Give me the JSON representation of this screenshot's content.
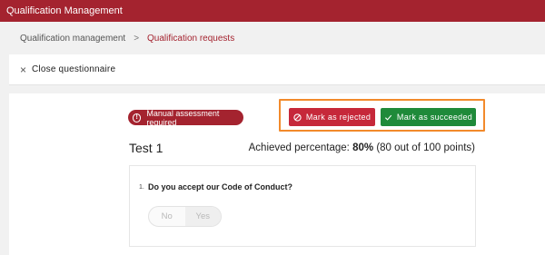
{
  "app": {
    "title": "Qualification Management"
  },
  "breadcrumb": {
    "root": "Qualification management",
    "separator": ">",
    "current": "Qualification requests"
  },
  "close_bar": {
    "label": "Close questionnaire"
  },
  "status_badge": {
    "label": "Manual assessment required"
  },
  "actions": {
    "reject_label": "Mark as rejected",
    "success_label": "Mark as succeeded"
  },
  "test": {
    "title": "Test 1",
    "achieved_label": "Achieved percentage:",
    "achieved_value": "80%",
    "achieved_detail": "(80 out of 100 points)"
  },
  "question": {
    "number": "1.",
    "text": "Do you accept our Code of Conduct?",
    "options": [
      "No",
      "Yes"
    ]
  },
  "colors": {
    "brand": "#a4232f",
    "reject": "#c6283a",
    "success": "#1f8a3a",
    "highlight": "#f28a2b"
  },
  "icons": {
    "close": "close-icon",
    "badge": "alert-circle-icon",
    "reject": "ban-icon",
    "success": "check-icon",
    "breadcrumb_sep": "chevron-right-icon"
  }
}
